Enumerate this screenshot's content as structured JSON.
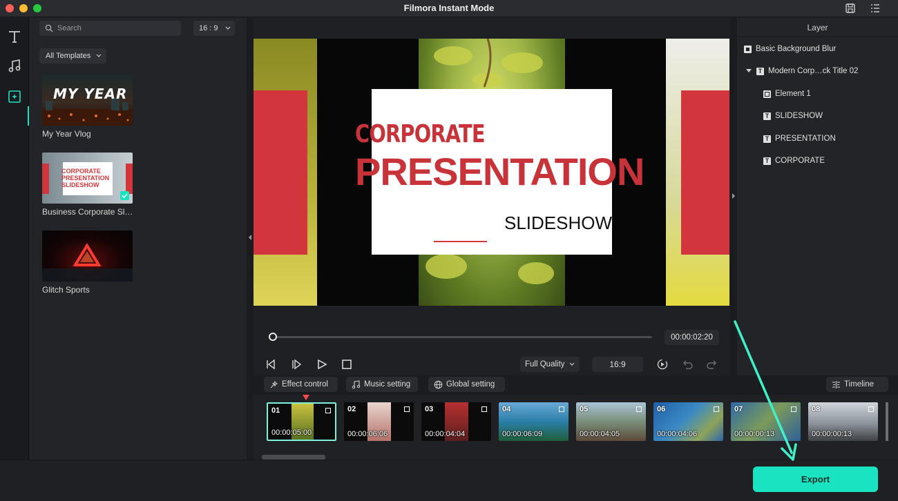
{
  "window": {
    "title": "Filmora Instant Mode"
  },
  "search": {
    "placeholder": "Search"
  },
  "aspect_dropdown": "16 : 9",
  "filter_dropdown": "All Templates",
  "templates": [
    {
      "name": "My Year Vlog",
      "thumb_text": "MY YEAR"
    },
    {
      "name": "Business Corporate Sl…",
      "thumb_text": "CORPORATE PRESENTATION SLIDESHOW"
    },
    {
      "name": "Glitch Sports"
    }
  ],
  "preview": {
    "line1": "CORPORATE",
    "line2": "PRESENTATION",
    "line3": "SLIDESHOW"
  },
  "layer_panel": {
    "header": "Layer",
    "items": [
      {
        "label": "Basic Background Blur",
        "icon": "image-layer-icon"
      },
      {
        "label": "Modern Corp…ck Title 02",
        "icon": "text-layer-icon"
      },
      {
        "label": "Element 1",
        "icon": "element-layer-icon"
      },
      {
        "label": "SLIDESHOW",
        "icon": "text-layer-icon"
      },
      {
        "label": "PRESENTATION",
        "icon": "text-layer-icon"
      },
      {
        "label": "CORPORATE",
        "icon": "text-layer-icon"
      }
    ]
  },
  "playback": {
    "timecode": "00:00:02:20",
    "quality": "Full Quality",
    "ratio": "16:9",
    "progress": 0.01
  },
  "settings": {
    "effect": "Effect control",
    "music": "Music setting",
    "global": "Global setting",
    "timeline": "Timeline"
  },
  "clips": [
    {
      "num": "01",
      "time": "00:00:05:00"
    },
    {
      "num": "02",
      "time": "00:00:06:06"
    },
    {
      "num": "03",
      "time": "00:00:04:04"
    },
    {
      "num": "04",
      "time": "00:00:06:09"
    },
    {
      "num": "05",
      "time": "00:00:04:05"
    },
    {
      "num": "06",
      "time": "00:00:04:06"
    },
    {
      "num": "07",
      "time": "00:00:00:13"
    },
    {
      "num": "08",
      "time": "00:00:00:13"
    }
  ],
  "export_label": "Export",
  "colors": {
    "accent": "#19e3c0",
    "brand_red": "#d2363c"
  }
}
